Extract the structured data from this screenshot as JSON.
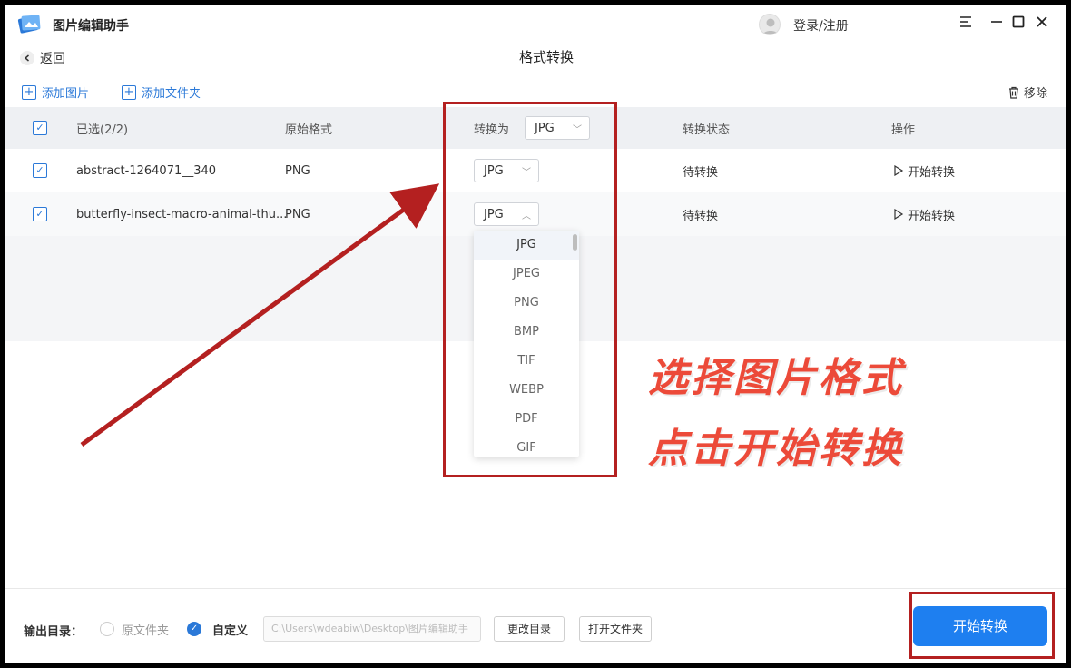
{
  "app": {
    "title": "图片编辑助手",
    "login": "登录/注册"
  },
  "window": {
    "menu": "☰",
    "minimize": "—",
    "maximize": "☐",
    "close": "✕"
  },
  "nav": {
    "back": "返回",
    "page_title": "格式转换"
  },
  "toolbar": {
    "add_image": "添加图片",
    "add_folder": "添加文件夹",
    "remove": "移除"
  },
  "table": {
    "headers": {
      "selected": "已选(2/2)",
      "orig_format": "原始格式",
      "convert_to": "转换为",
      "convert_to_value": "JPG",
      "status": "转换状态",
      "action": "操作"
    },
    "rows": [
      {
        "name": "abstract-1264071__340",
        "format": "PNG",
        "target": "JPG",
        "status": "待转换",
        "action": "开始转换"
      },
      {
        "name": "butterfly-insect-macro-animal-thu...",
        "format": "PNG",
        "target": "JPG",
        "status": "待转换",
        "action": "开始转换"
      }
    ]
  },
  "dropdown": {
    "options": [
      "JPG",
      "JPEG",
      "PNG",
      "BMP",
      "TIF",
      "WEBP",
      "PDF",
      "GIF"
    ],
    "selected": "JPG"
  },
  "annotation": {
    "line1": "选择图片格式",
    "line2": "点击开始转换",
    "color": "#ec4a39",
    "box_color": "#b42020"
  },
  "bottom": {
    "output_label": "输出目录：",
    "radio_original": "原文件夹",
    "radio_custom": "自定义",
    "path": "C:\\Users\\wdeabiw\\Desktop\\图片编辑助手",
    "change_dir": "更改目录",
    "open_folder": "打开文件夹",
    "start": "开始转换"
  },
  "colors": {
    "accent": "#1e7ff0",
    "link": "#2b79d8"
  }
}
